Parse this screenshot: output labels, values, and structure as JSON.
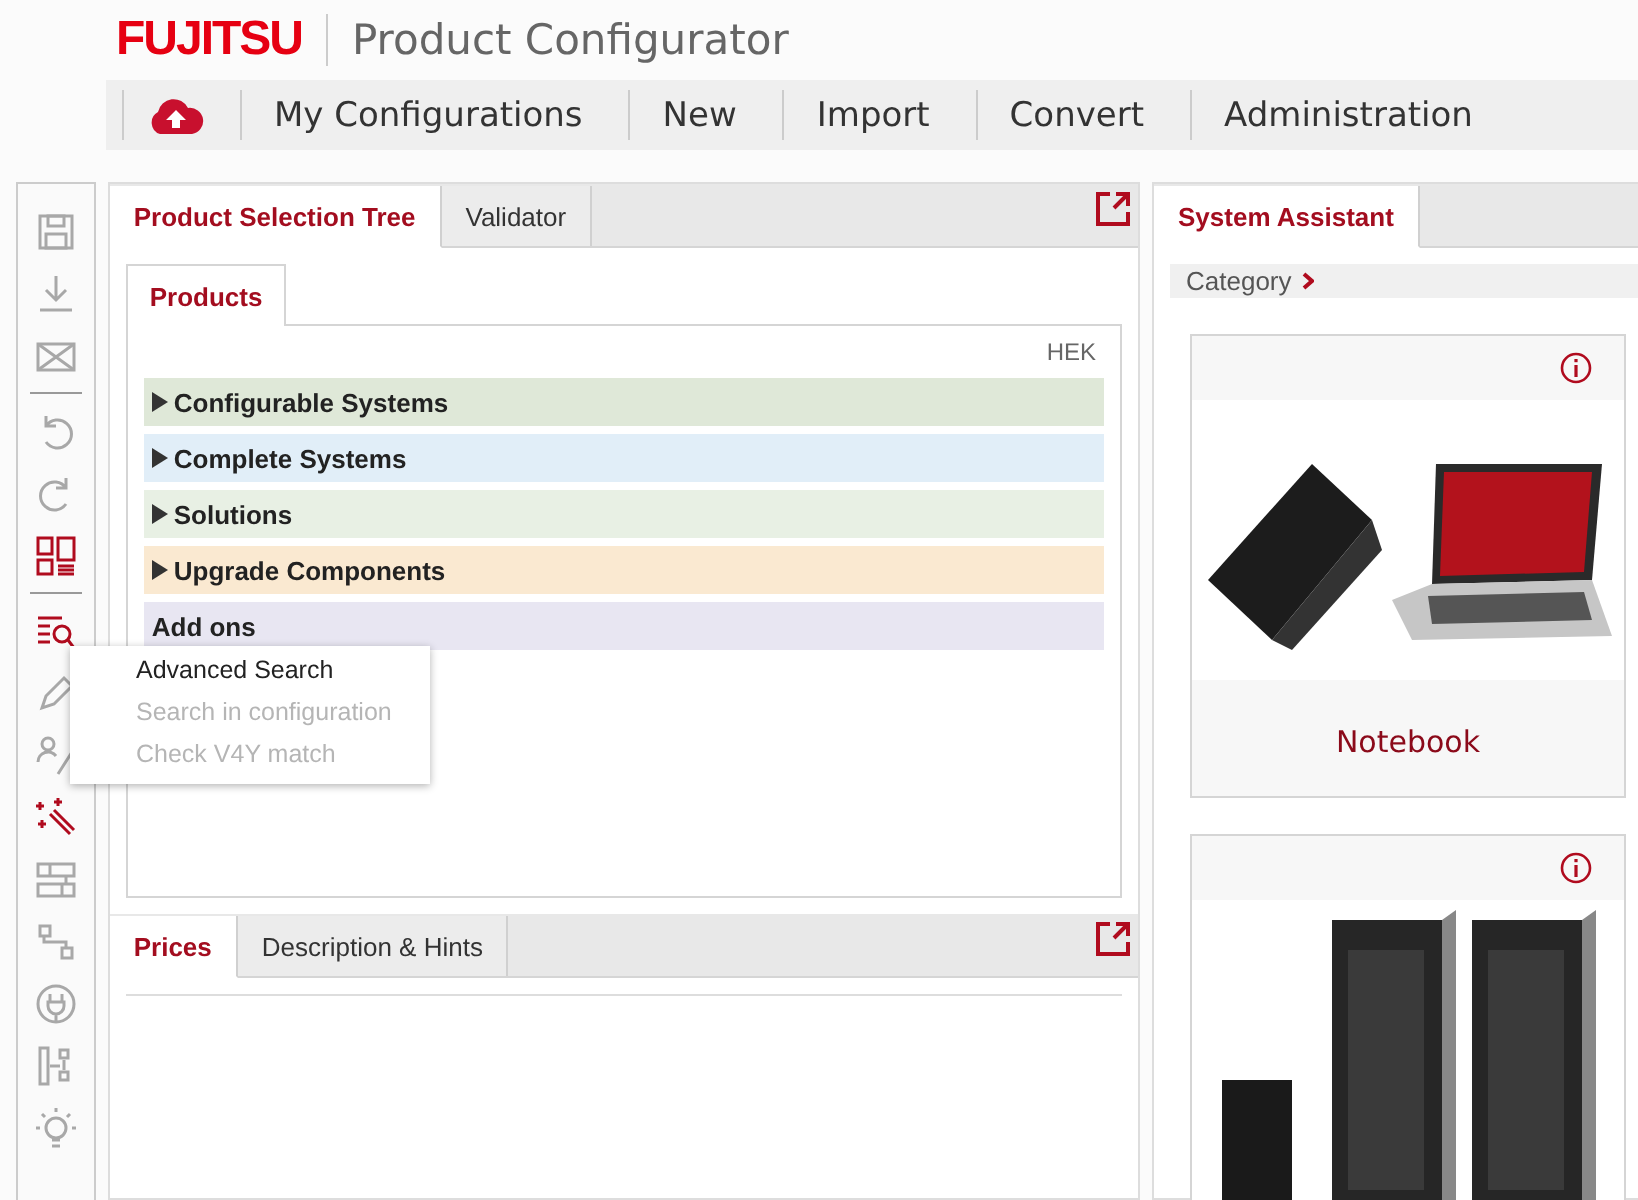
{
  "header": {
    "logo": "FUJITSU",
    "title": "Product Configurator"
  },
  "nav": [
    "My Configurations",
    "New",
    "Import",
    "Convert",
    "Administration"
  ],
  "toolbar": [
    {
      "kind": "button",
      "enabled": false
    },
    {
      "kind": "button",
      "enabled": false
    },
    {
      "kind": "button",
      "enabled": false
    },
    {
      "kind": "separator"
    },
    {
      "kind": "button",
      "enabled": false
    },
    {
      "kind": "button",
      "enabled": false
    },
    {
      "kind": "button",
      "enabled": true
    },
    {
      "kind": "separator"
    },
    {
      "kind": "button",
      "enabled": true
    },
    {
      "kind": "button",
      "enabled": false
    },
    {
      "kind": "button",
      "enabled": false
    },
    {
      "kind": "button",
      "enabled": true
    },
    {
      "kind": "button",
      "enabled": false
    },
    {
      "kind": "button",
      "enabled": false
    },
    {
      "kind": "button",
      "enabled": false
    },
    {
      "kind": "button",
      "enabled": false
    },
    {
      "kind": "button",
      "enabled": false
    }
  ],
  "menu": [
    {
      "label": "Advanced Search",
      "disabled": false
    },
    {
      "label": "Search in configuration",
      "disabled": true
    },
    {
      "label": "Check V4Y match",
      "disabled": true
    }
  ],
  "main_tabs": [
    {
      "label": "Product Selection Tree",
      "selected": true
    },
    {
      "label": "Validator",
      "selected": false
    }
  ],
  "sub_tabs": [
    {
      "label": "Products",
      "selected": true
    }
  ],
  "hek": "HEK",
  "tree": [
    {
      "label": "Configurable Systems",
      "color": "#dfe8d8",
      "expandable": true
    },
    {
      "label": "Complete Systems",
      "color": "#e1eef8",
      "expandable": true
    },
    {
      "label": "Solutions",
      "color": "#e8f0e4",
      "expandable": true
    },
    {
      "label": "Upgrade Components",
      "color": "#fae9d1",
      "expandable": true
    },
    {
      "label": "Add ons",
      "color": "#e8e6f2",
      "expandable": false
    }
  ],
  "bottom_tabs": [
    {
      "label": "Prices",
      "selected": true
    },
    {
      "label": "Description & Hints",
      "selected": false
    }
  ],
  "assistant_tabs": [
    {
      "label": "System Assistant",
      "selected": true
    }
  ],
  "breadcrumb": "Category",
  "cards": [
    {
      "kind": "notebook",
      "label": "Notebook"
    },
    {
      "kind": "server"
    }
  ]
}
